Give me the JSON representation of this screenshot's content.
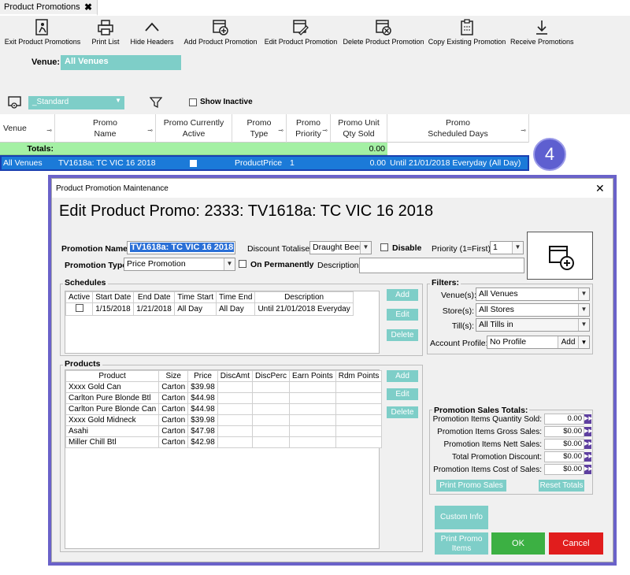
{
  "tab": {
    "title": "Product Promotions",
    "close": "✖"
  },
  "toolbar": [
    {
      "label": "Exit Product Promotions",
      "icon": "exit-icon"
    },
    {
      "label": "Print List",
      "icon": "printer-icon"
    },
    {
      "label": "Hide Headers",
      "icon": "chevron-up-icon"
    },
    {
      "label": "Add Product Promotion",
      "icon": "add-promotion-icon"
    },
    {
      "label": "Edit Product Promotion",
      "icon": "edit-promotion-icon"
    },
    {
      "label": "Delete Product Promotion",
      "icon": "delete-promotion-icon"
    },
    {
      "label": "Copy Existing Promotion",
      "icon": "copy-promotion-icon"
    },
    {
      "label": "Receive Promotions",
      "icon": "download-icon"
    }
  ],
  "venue": {
    "label": "Venue:",
    "value": "All Venues"
  },
  "layout": {
    "value": "_Standard"
  },
  "show_inactive": {
    "label": "Show Inactive",
    "checked": false
  },
  "grid": {
    "columns": [
      "Venue",
      "Promo\nName",
      "Promo Currently\nActive",
      "Promo\nType",
      "Promo\nPriority",
      "Promo Unit\nQty Sold",
      "Promo\nScheduled Days"
    ],
    "totals_label": "Totals:",
    "totals_qty": "0.00",
    "row": {
      "venue": "All Venues",
      "name": "TV1618a: TC VIC 16 2018",
      "active": false,
      "type": "ProductPrice",
      "priority": "1",
      "qty": "0.00",
      "days": "Until 21/01/2018 Everyday (All Day)"
    }
  },
  "badge": "4",
  "dialog": {
    "title": "Product Promotion Maintenance",
    "heading": "Edit Product Promo: 2333: TV1618a: TC VIC 16 2018",
    "promotion_name_label": "Promotion Name:",
    "promotion_name": "TV1618a: TC VIC 16 2018",
    "discount_totaliser_label": "Discount Totaliser:",
    "discount_totaliser": "Draught Beer",
    "disable_label": "Disable",
    "priority_label": "Priority (1=First):",
    "priority": "1",
    "promotion_type_label": "Promotion Type:",
    "promotion_type": "Price Promotion",
    "on_permanently_label": "On Permanently",
    "description_label": "Description:",
    "description": "",
    "schedules": {
      "title": "Schedules",
      "columns": [
        "Active",
        "Start Date",
        "End Date",
        "Time Start",
        "Time End",
        "Description"
      ],
      "rows": [
        {
          "active": false,
          "start": "1/15/2018",
          "end": "1/21/2018",
          "tstart": "All Day",
          "tend": "All Day",
          "desc": "Until 21/01/2018 Everyday"
        }
      ],
      "add": "Add",
      "edit": "Edit",
      "delete": "Delete"
    },
    "filters": {
      "title": "Filters:",
      "venues_label": "Venue(s):",
      "venues": "All Venues",
      "stores_label": "Store(s):",
      "stores": "All Stores",
      "tills_label": "Till(s):",
      "tills": "All Tills in",
      "account_label": "Account Profile:",
      "account": "No Profile",
      "account_add": "Add"
    },
    "products": {
      "title": "Products",
      "columns": [
        "Product",
        "Size",
        "Price",
        "DiscAmt",
        "DiscPerc",
        "Earn Points",
        "Rdm Points"
      ],
      "rows": [
        {
          "product": "Xxxx Gold Can",
          "size": "Carton",
          "price": "$39.98"
        },
        {
          "product": "Carlton Pure Blonde Btl",
          "size": "Carton",
          "price": "$44.98"
        },
        {
          "product": "Carlton Pure Blonde Can",
          "size": "Carton",
          "price": "$44.98"
        },
        {
          "product": "Xxxx Gold Midneck",
          "size": "Carton",
          "price": "$39.98"
        },
        {
          "product": "Asahi",
          "size": "Carton",
          "price": "$47.98"
        },
        {
          "product": "Miller Chill Btl",
          "size": "Carton",
          "price": "$42.98"
        }
      ],
      "add": "Add",
      "edit": "Edit",
      "delete": "Delete"
    },
    "sales_totals": {
      "title": "Promotion Sales Totals:",
      "rows": [
        {
          "label": "Promotion Items Quantity Sold:",
          "value": "0.00"
        },
        {
          "label": "Promotion Items Gross Sales:",
          "value": "$0.00"
        },
        {
          "label": "Promotion Items Nett Sales:",
          "value": "$0.00"
        },
        {
          "label": "Total Promotion Discount:",
          "value": "$0.00"
        },
        {
          "label": "Promotion Items Cost of Sales:",
          "value": "$0.00"
        }
      ],
      "print": "Print Promo Sales",
      "reset": "Reset Totals"
    },
    "custom_info": "Custom Info",
    "print_items": "Print Promo Items",
    "ok": "OK",
    "cancel": "Cancel"
  },
  "colors": {
    "accent": "#7ecec8",
    "selection": "#1b7ad8",
    "totals": "#a4f0a4",
    "frame": "#6a62c9",
    "ok": "#3cb043",
    "cancel": "#e11d1d"
  }
}
